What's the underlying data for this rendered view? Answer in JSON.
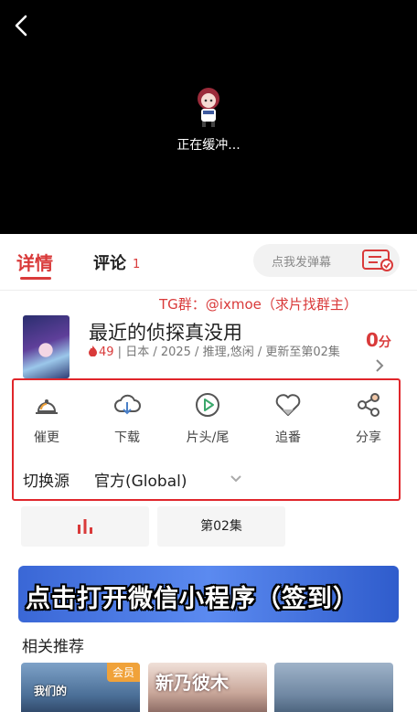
{
  "player": {
    "buffer_text": "正在缓冲..."
  },
  "tabs": {
    "detail": "详情",
    "comment": "评论",
    "comment_count": "1",
    "danmaku_placeholder": "点我发弹幕"
  },
  "info": {
    "tg_line": "TG群：@ixmoe（求片找群主）",
    "title": "最近的侦探真没用",
    "heat": "49",
    "meta": " | 日本 / 2025 / 推理,悠闲 / 更新至第02集",
    "score": "0",
    "score_unit": "分"
  },
  "actions": [
    {
      "label": "催更",
      "icon": "bell-icon"
    },
    {
      "label": "下载",
      "icon": "cloud-download-icon"
    },
    {
      "label": "片头/尾",
      "icon": "play-circle-icon"
    },
    {
      "label": "追番",
      "icon": "heart-icon"
    },
    {
      "label": "分享",
      "icon": "share-icon"
    }
  ],
  "source": {
    "label": "切换源",
    "value": "官方(Global)"
  },
  "episodes": {
    "current": "第02集"
  },
  "banner": {
    "text": "点击打开微信小程序（签到）"
  },
  "recommend": {
    "title": "相关推荐",
    "badge": "会员",
    "card1_text": "我们的",
    "card2_text": "新乃彼木"
  },
  "colors": {
    "accent": "#d93a3a",
    "highlight_border": "#e0262b",
    "banner_blue": "#3a67d6",
    "badge_orange": "#f0a23a"
  }
}
